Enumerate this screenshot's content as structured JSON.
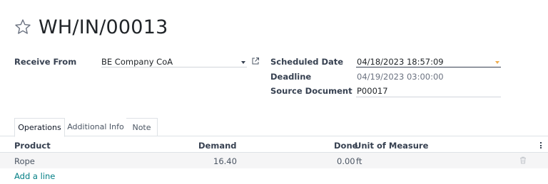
{
  "record": {
    "title": "WH/IN/00013"
  },
  "form": {
    "receive_from": {
      "label": "Receive From",
      "value": "BE Company CoA"
    },
    "scheduled_date": {
      "label": "Scheduled Date",
      "value": "04/18/2023 18:57:09"
    },
    "deadline": {
      "label": "Deadline",
      "value": "04/19/2023 03:00:00"
    },
    "source_document": {
      "label": "Source Document",
      "value": "P00017"
    }
  },
  "tabs": [
    {
      "label": "Operations",
      "active": true
    },
    {
      "label": "Additional Info",
      "active": false
    },
    {
      "label": "Note",
      "active": false
    }
  ],
  "table": {
    "headers": {
      "product": "Product",
      "demand": "Demand",
      "done": "Done",
      "uom": "Unit of Measure"
    },
    "rows": [
      {
        "product": "Rope",
        "demand": "16.40",
        "done": "0.00",
        "uom": "ft"
      }
    ],
    "add_line": "Add a line"
  },
  "icons": {
    "favorite": "star-outline-icon",
    "external_link": "external-link-icon",
    "dropdown": "caret-down-icon",
    "row_delete": "trash-icon",
    "column_options": "kebab-icon"
  },
  "colors": {
    "link": "#017e84",
    "date_caret": "#f0ad4e",
    "text": "#212529",
    "row_background": "#f5f5f6"
  }
}
